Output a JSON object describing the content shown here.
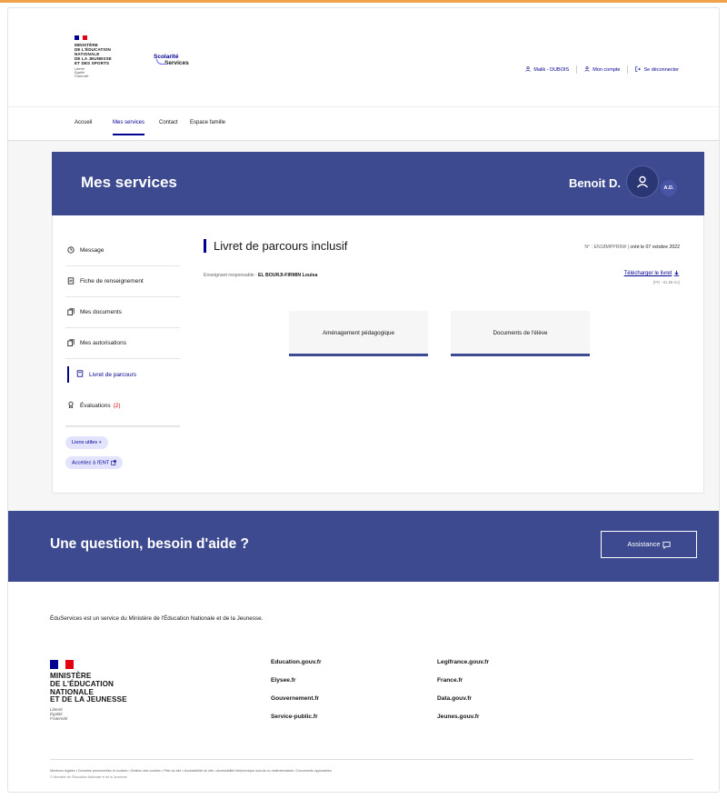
{
  "header": {
    "ministry_lines": "Ministère\nde l'Éducation\nnationale\nde la Jeunesse\net des Sports",
    "motto": "Liberté\nÉgalité\nFraternité",
    "service_logo_line1": "Scolarité",
    "service_logo_line2": "Services",
    "tools": {
      "user": "Malik - DUBOIS",
      "account": "Mon compte",
      "logout": "Se déconnecter"
    }
  },
  "nav": {
    "items": [
      "Accueil",
      "Mes services",
      "Contact",
      "Espace famille"
    ],
    "active": "Mes services"
  },
  "banner": {
    "title": "Mes services",
    "user_name": "Benoit D.",
    "badge_initials": "A.D."
  },
  "sidebar": {
    "items": [
      {
        "label": "Message",
        "icon": "clock-icon"
      },
      {
        "label": "Fiche de renseignement",
        "icon": "form-icon"
      },
      {
        "label": "Mes documents",
        "icon": "documents-icon"
      },
      {
        "label": "Mes autorisations",
        "icon": "documents-icon"
      },
      {
        "label": "Livret de parcours",
        "icon": "booklet-icon",
        "active": true
      },
      {
        "label": "Évaluations",
        "icon": "award-icon",
        "count": "(2)"
      }
    ],
    "chips": [
      "Liens utiles +",
      "Accédez à l'ENT"
    ]
  },
  "main": {
    "title": "Livret de parcours inclusif",
    "number_label": "N° : EN18MPPR9W",
    "created_label": "créé le 07 octobre 2022",
    "teacher_label": "Enseignant responsable :",
    "teacher_name": "EL BOURJI-FIRMIN Louisa",
    "download_label": "Télécharger le livret",
    "download_size": "(PO - 61,88 Ko)",
    "tiles": [
      "Aménagement pédagogique",
      "Documents de l'élève"
    ]
  },
  "help": {
    "title": "Une question, besoin d'aide ?",
    "button": "Assistance"
  },
  "footer": {
    "description": "ÉduServices est un service du Ministère de l'Éducation Nationale et de la Jeunesse.",
    "ministry_lines": "Ministère\nde l'Éducation\nnationale\net de la Jeunesse",
    "motto": "Liberté\nÉgalité\nFraternité",
    "links_col1": [
      "Education.gouv.fr",
      "Elysee.fr",
      "Gouvernement.fr",
      "Service-public.fr"
    ],
    "links_col2": [
      "Legifrance.gouv.fr",
      "France.fr",
      "Data.gouv.fr",
      "Jeunes.gouv.fr"
    ],
    "legal": "Mentions légales  •  Données personnelles et cookies  •  Gestion des cookies  •  Plan du site  •  Accessibilité du site  •  Accessibilité téléphonique sourds ou malentendants  •  Documents opposables",
    "copyright": "© Ministère de l'Éducation Nationale et de la Jeunesse"
  },
  "colors": {
    "brand_blue": "#000091",
    "banner_blue": "#3d4a8f",
    "accent_red": "#e1000f",
    "frame_orange": "#f0a44a"
  }
}
